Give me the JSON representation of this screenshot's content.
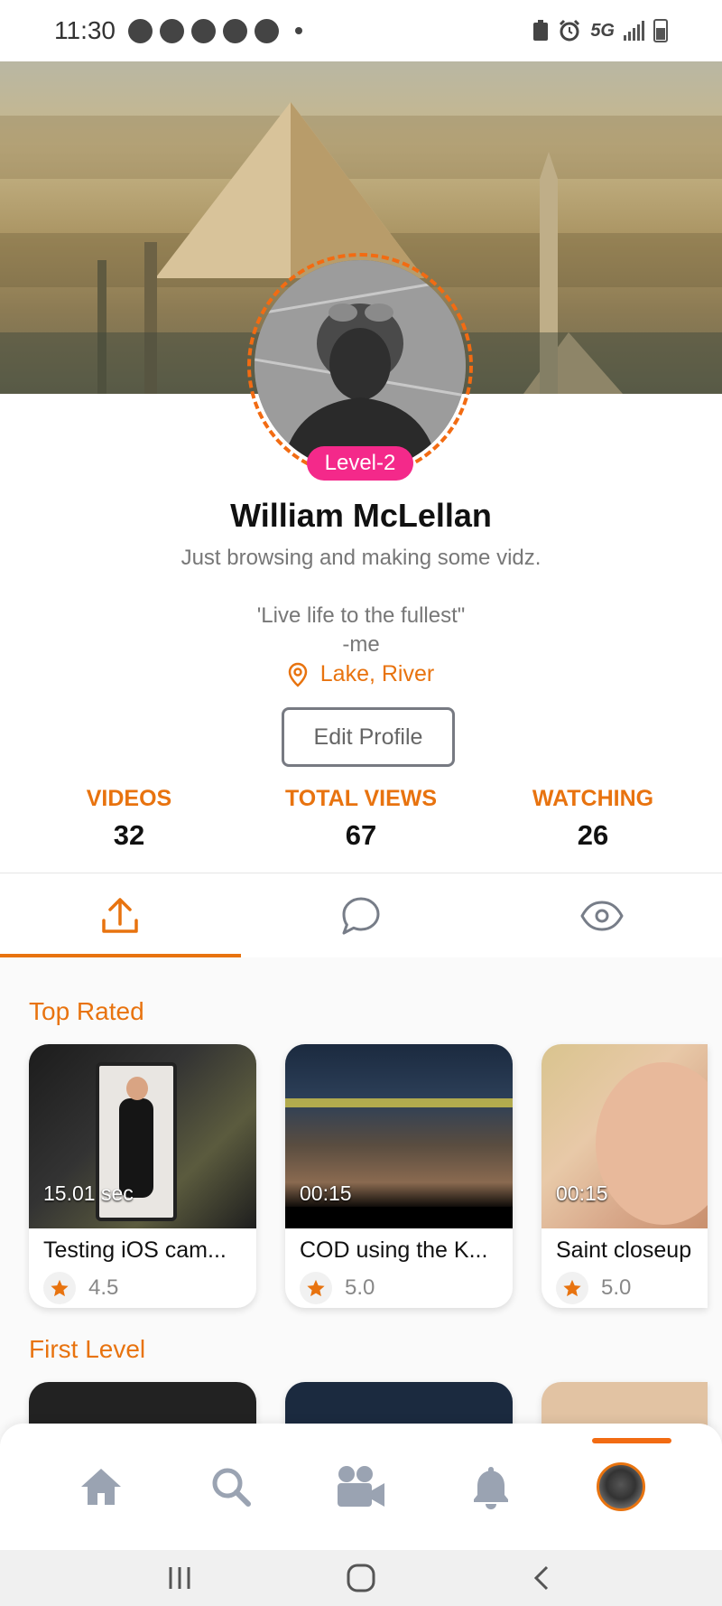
{
  "status_bar": {
    "time": "11:30",
    "network": "5G"
  },
  "profile": {
    "level_badge": "Level-2",
    "name": "William McLellan",
    "bio": "Just browsing and making some vidz.",
    "quote": "'Live life to the fullest\"\n-me",
    "location": "Lake, River",
    "edit_button": "Edit Profile"
  },
  "stats": [
    {
      "label": "VIDEOS",
      "value": "32"
    },
    {
      "label": "TOTAL VIEWS",
      "value": "67"
    },
    {
      "label": "WATCHING",
      "value": "26"
    }
  ],
  "tabs": [
    {
      "icon": "upload-icon",
      "active": true
    },
    {
      "icon": "chat-bubble-icon",
      "active": false
    },
    {
      "icon": "eye-icon",
      "active": false
    }
  ],
  "sections": [
    {
      "title": "Top Rated",
      "videos": [
        {
          "duration": "15.01 sec",
          "title": "Testing iOS cam...",
          "rating": "4.5"
        },
        {
          "duration": "00:15",
          "title": "COD using the K...",
          "rating": "5.0"
        },
        {
          "duration": "00:15",
          "title": "Saint closeup",
          "rating": "5.0"
        }
      ]
    },
    {
      "title": "First Level",
      "videos": []
    }
  ],
  "bottom_nav": [
    {
      "icon": "home-icon"
    },
    {
      "icon": "search-icon"
    },
    {
      "icon": "video-camera-icon"
    },
    {
      "icon": "bell-icon"
    },
    {
      "icon": "profile-avatar-icon",
      "active": true
    }
  ],
  "colors": {
    "accent": "#e8730f",
    "level_badge": "#f4298a",
    "nav_icon": "#9aa3b2"
  }
}
